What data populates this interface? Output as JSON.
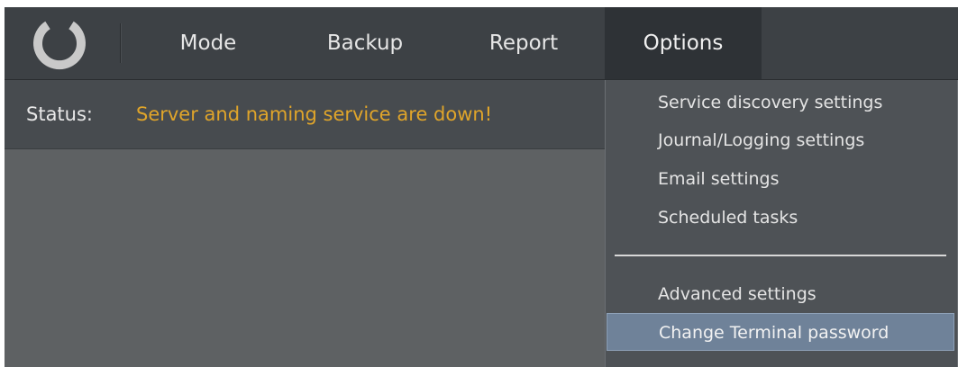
{
  "menubar": {
    "items": [
      {
        "label": "Mode"
      },
      {
        "label": "Backup"
      },
      {
        "label": "Report"
      },
      {
        "label": "Options"
      }
    ],
    "active": "Options"
  },
  "status": {
    "label": "Status:",
    "message": "Server and naming service are down!",
    "message_color": "#e0a52a"
  },
  "options_menu": {
    "items": [
      {
        "label": "Service discovery settings"
      },
      {
        "label": "Journal/Logging settings"
      },
      {
        "label": "Email settings"
      },
      {
        "label": "Scheduled tasks"
      },
      {
        "label": "Advanced settings"
      },
      {
        "label": "Change Terminal password"
      }
    ],
    "highlighted": "Change Terminal password",
    "highlight_color": "#6f8299"
  },
  "icons": {
    "logo": "ring-logo-icon"
  }
}
